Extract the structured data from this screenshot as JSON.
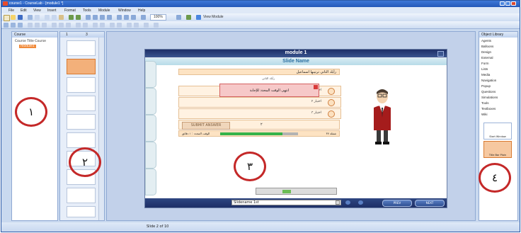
{
  "window": {
    "title": "course1 - CourseLab - [module1 *]"
  },
  "menu": [
    "File",
    "Edit",
    "View",
    "Insert",
    "Format",
    "Tools",
    "Module",
    "Window",
    "Help"
  ],
  "toolbar": {
    "zoom": "100%",
    "view_module": "View Module"
  },
  "course_panel": {
    "header": "Course",
    "tree_root": "Course Title Course",
    "tree_child": "module1"
  },
  "thumbs_panel": {
    "tab1": "1",
    "tab2": "3"
  },
  "module": {
    "title": "module 1",
    "slide_name": "Slide Name",
    "question": "رأيك الثاني ترتيبها اسماعيل",
    "hint": "رأيك الثاني",
    "options": [
      "اختيار ١",
      "اختيار ٢",
      "اختيار ٣"
    ],
    "submit_label": "SUBMIT ANSWER",
    "popup_text": "انتهى الوقت المحدد للإجابة",
    "progress_left": "الوقت المحدد : ١ دقائق",
    "progress_right": "شفلة ٣٧",
    "progress_fraction": 0.8,
    "submit_counter": "٢",
    "slide_selector": "Slidename 1st",
    "prev_label": "PREV",
    "next_label": "NEXT"
  },
  "library": {
    "header": "Object Library",
    "items": [
      "Agents",
      "Balloons",
      "Design",
      "External",
      "Form",
      "Lists",
      "Media",
      "Navigation",
      "Popup",
      "Questions",
      "Simulations",
      "Tools",
      "Textboxes",
      "Wiki"
    ],
    "thumb1": "Start Window",
    "thumb2": "Title Bar Plain"
  },
  "status": {
    "text": "Slide 2 of 10"
  },
  "annotations": {
    "c1": "١",
    "c2": "٢",
    "c3": "٣",
    "c4": "٤"
  },
  "colors": {
    "accent": "#2458b8",
    "annotation_red": "#c42828",
    "progress_green": "#35b34a"
  }
}
